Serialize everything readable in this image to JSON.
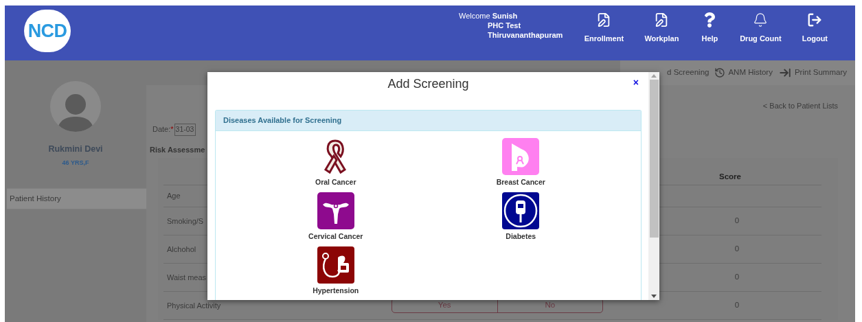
{
  "header": {
    "logo": "NCD",
    "welcome": "Welcome",
    "user": "Sunish",
    "lines": [
      "PHC Test",
      "Thiruvananthapuram"
    ],
    "nav": [
      {
        "label": "Enrollment"
      },
      {
        "label": "Workplan"
      },
      {
        "label": "Help"
      },
      {
        "label": "Drug Count"
      },
      {
        "label": "Logout"
      }
    ]
  },
  "patient": {
    "name": "Rukmini Devi",
    "age_sex": "46 YRS,F"
  },
  "sidebar": {
    "items": [
      {
        "label": "Patient History",
        "selected": true
      }
    ]
  },
  "toolbar": [
    {
      "label": "d Screening"
    },
    {
      "label": "ANM History"
    },
    {
      "label": "Print Summary"
    }
  ],
  "back_link": "< Back to Patient Lists",
  "date": {
    "label": "Date:",
    "required_mark": "*",
    "value": "31-03"
  },
  "section_title": "Risk Assessme",
  "table": {
    "score_heading": "Score",
    "rows": [
      {
        "label": "Age",
        "score": ""
      },
      {
        "label": "Smoking/S",
        "score": "0"
      },
      {
        "label": "Alchohol",
        "score": "0"
      },
      {
        "label": "Waist meas",
        "score": "0"
      },
      {
        "label": "Physical Activity",
        "score": "0",
        "options": [
          "Yes",
          "No"
        ]
      }
    ]
  },
  "modal": {
    "title": "Add Screening",
    "close": "×",
    "panel_heading": "Diseases Available for Screening",
    "diseases": [
      {
        "label": "Oral Cancer"
      },
      {
        "label": "Breast Cancer"
      },
      {
        "label": "Cervical Cancer"
      },
      {
        "label": "Diabetes"
      },
      {
        "label": "Hypertension"
      }
    ]
  }
}
